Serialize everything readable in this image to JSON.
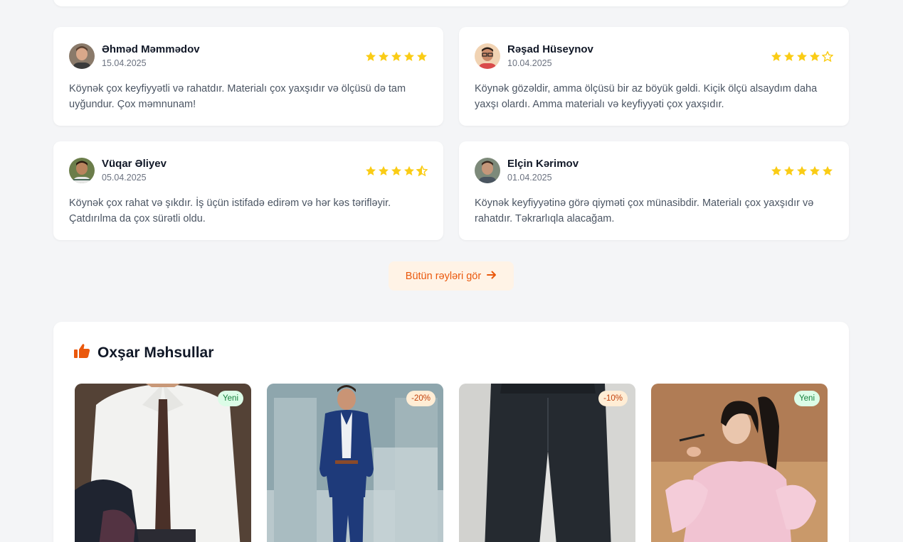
{
  "reviews": [
    {
      "name": "Əhməd Məmmədov",
      "date": "15.04.2025",
      "rating": 5,
      "text": "Köynək çox keyfiyyətli və rahatdır. Materialı çox yaxşıdır və ölçüsü də tam uyğundur. Çox məmnunam!"
    },
    {
      "name": "Rəşad Hüseynov",
      "date": "10.04.2025",
      "rating": 4,
      "text": "Köynək gözəldir, amma ölçüsü bir az böyük gəldi. Kiçik ölçü alsaydım daha yaxşı olardı. Amma materialı və keyfiyyəti çox yaxşıdır."
    },
    {
      "name": "Vüqar Əliyev",
      "date": "05.04.2025",
      "rating": 4.5,
      "text": "Köynək çox rahat və şıkdır. İş üçün istifadə edirəm və hər kəs tərifləyir. Çatdırılma da çox sürətli oldu."
    },
    {
      "name": "Elçin Kərimov",
      "date": "01.04.2025",
      "rating": 5,
      "text": "Köynək keyfiyyətinə görə qiyməti çox münasibdir. Materialı çox yaxşıdır və rahatdır. Təkrarlıqla alacağam."
    }
  ],
  "all_reviews_label": "Bütün rəyləri gör",
  "similar": {
    "title": "Oxşar Məhsullar",
    "products": [
      {
        "badge": "Yeni",
        "badge_type": "new",
        "image": "white-shirt-tie-photo"
      },
      {
        "badge": "-20%",
        "badge_type": "sale",
        "image": "navy-suit-photo"
      },
      {
        "badge": "-10%",
        "badge_type": "sale",
        "image": "dark-jeans-photo"
      },
      {
        "badge": "Yeni",
        "badge_type": "new",
        "image": "pink-dress-photo"
      }
    ]
  },
  "colors": {
    "accent": "#ea580c",
    "star": "#facc15",
    "badge_new_bg": "#dcfce7",
    "badge_sale_bg": "#ffedd5"
  }
}
